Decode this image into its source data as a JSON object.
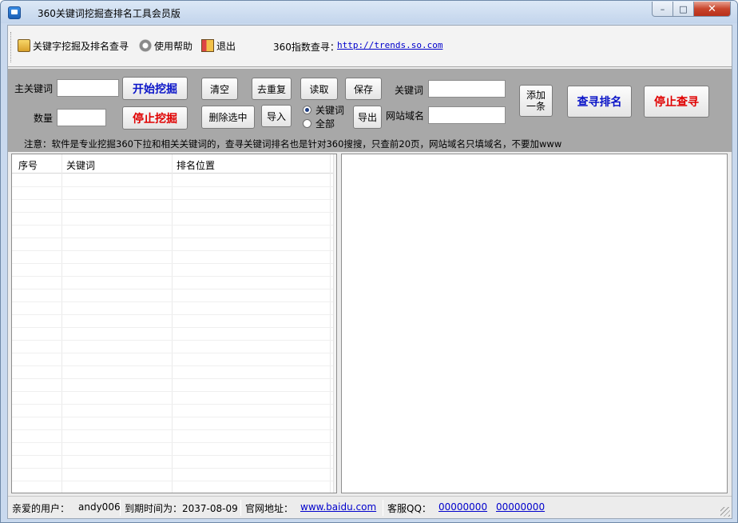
{
  "window": {
    "title": "360关键词挖掘查排名工具会员版"
  },
  "menu": {
    "items": [
      {
        "label": "关键字挖掘及排名查寻",
        "icon": "home-icon"
      },
      {
        "label": "使用帮助",
        "icon": "gear-icon"
      },
      {
        "label": "退出",
        "icon": "exit-icon"
      }
    ],
    "index_label": "360指数查寻：",
    "index_link": "http://trends.so.com"
  },
  "panel": {
    "main_keyword_label": "主关键词",
    "main_keyword_value": "",
    "count_label": "数量",
    "count_value": "",
    "start_mining": "开始挖掘",
    "stop_mining": "停止挖掘",
    "clear": "清空",
    "dedupe": "去重复",
    "delete_selected": "删除选中",
    "read": "读取",
    "import": "导入",
    "save": "保存",
    "export": "导出",
    "radio_keyword": "关键词",
    "radio_all": "全部",
    "keyword_label": "关键词",
    "keyword_value": "",
    "domain_label": "网站域名",
    "domain_value": "",
    "add_one_line1": "添加",
    "add_one_line2": "一条",
    "query_rank": "查寻排名",
    "stop_query": "停止查寻",
    "notice": "注意：软件是专业挖掘360下拉和相关关键词的，查寻关键词排名也是针对360搜搜，只查前20页，网站域名只填域名，不要加www"
  },
  "list": {
    "columns": [
      "序号",
      "关键词",
      "排名位置"
    ]
  },
  "status": {
    "user_label": "亲爱的用户：",
    "user_name": "andy006",
    "expire": "到期时间为：2037-08-09",
    "site_label": "官网地址：",
    "site_link": "www.baidu.com",
    "qq_label": "客服QQ：",
    "qq1": "00000000",
    "qq2": "00000000"
  },
  "colors": {
    "accent_blue": "#0a14c8",
    "accent_red": "#e00000",
    "link": "#0000cc",
    "panel_gray": "#a8a8a8"
  }
}
